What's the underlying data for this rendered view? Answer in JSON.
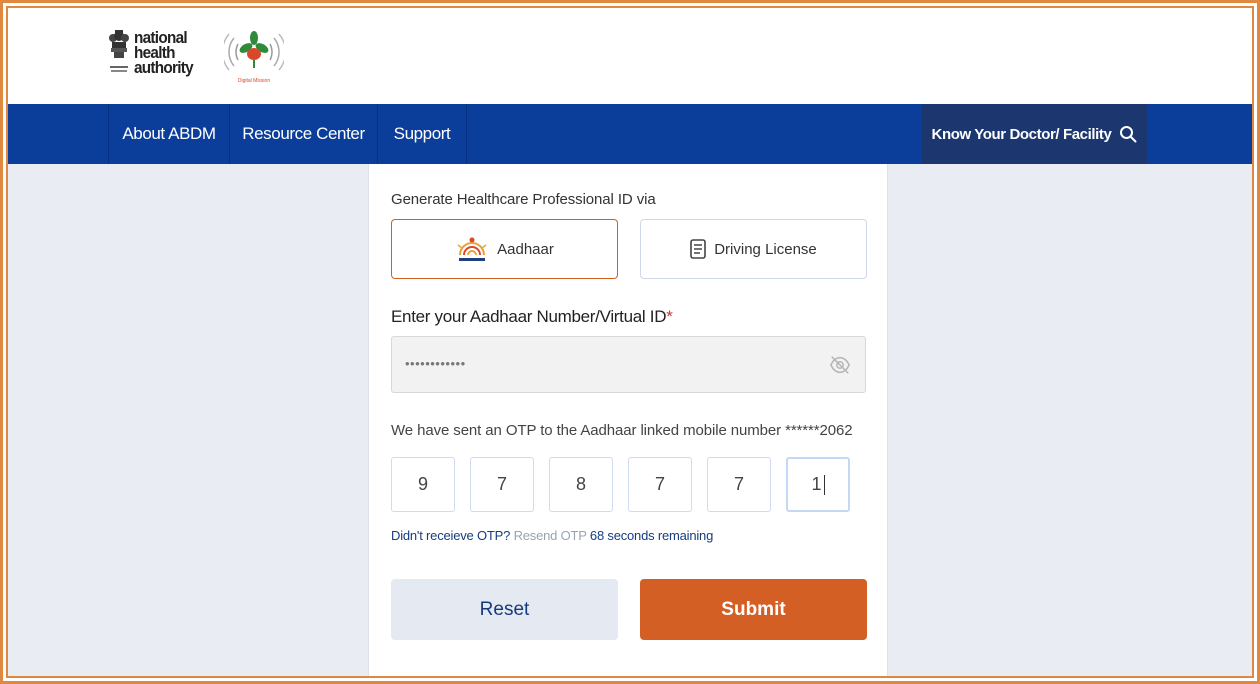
{
  "header": {
    "nha_logo_lines": [
      "national",
      "health",
      "authority"
    ],
    "abdm_logo_caption": "Digital Mission"
  },
  "nav": {
    "items": [
      {
        "label": "About ABDM"
      },
      {
        "label": "Resource Center"
      },
      {
        "label": "Support"
      }
    ],
    "know_label": "Know Your Doctor/ Facility",
    "know_icon": "search-icon"
  },
  "form": {
    "generate_label": "Generate Healthcare Professional ID via",
    "options": [
      {
        "label": "Aadhaar",
        "icon": "aadhaar-logo-icon",
        "selected": true
      },
      {
        "label": "Driving License",
        "icon": "document-icon",
        "selected": false
      }
    ],
    "aadhaar_label": "Enter your Aadhaar Number/Virtual ID",
    "required_mark": "*",
    "aadhaar_value": "••••••••••••",
    "eye_icon": "eye-off-icon",
    "otp_message": "We have sent an OTP to the Aadhaar linked mobile number ******2062",
    "otp_digits": [
      "9",
      "7",
      "8",
      "7",
      "7",
      "1"
    ],
    "resend_question": "Didn't receieve OTP?",
    "resend_link": "Resend OTP",
    "resend_seconds": "68 seconds remaining",
    "reset_label": "Reset",
    "submit_label": "Submit"
  },
  "colors": {
    "nav_bg": "#0b3d9a",
    "accent": "#d45f25",
    "frame": "#e0883f"
  }
}
